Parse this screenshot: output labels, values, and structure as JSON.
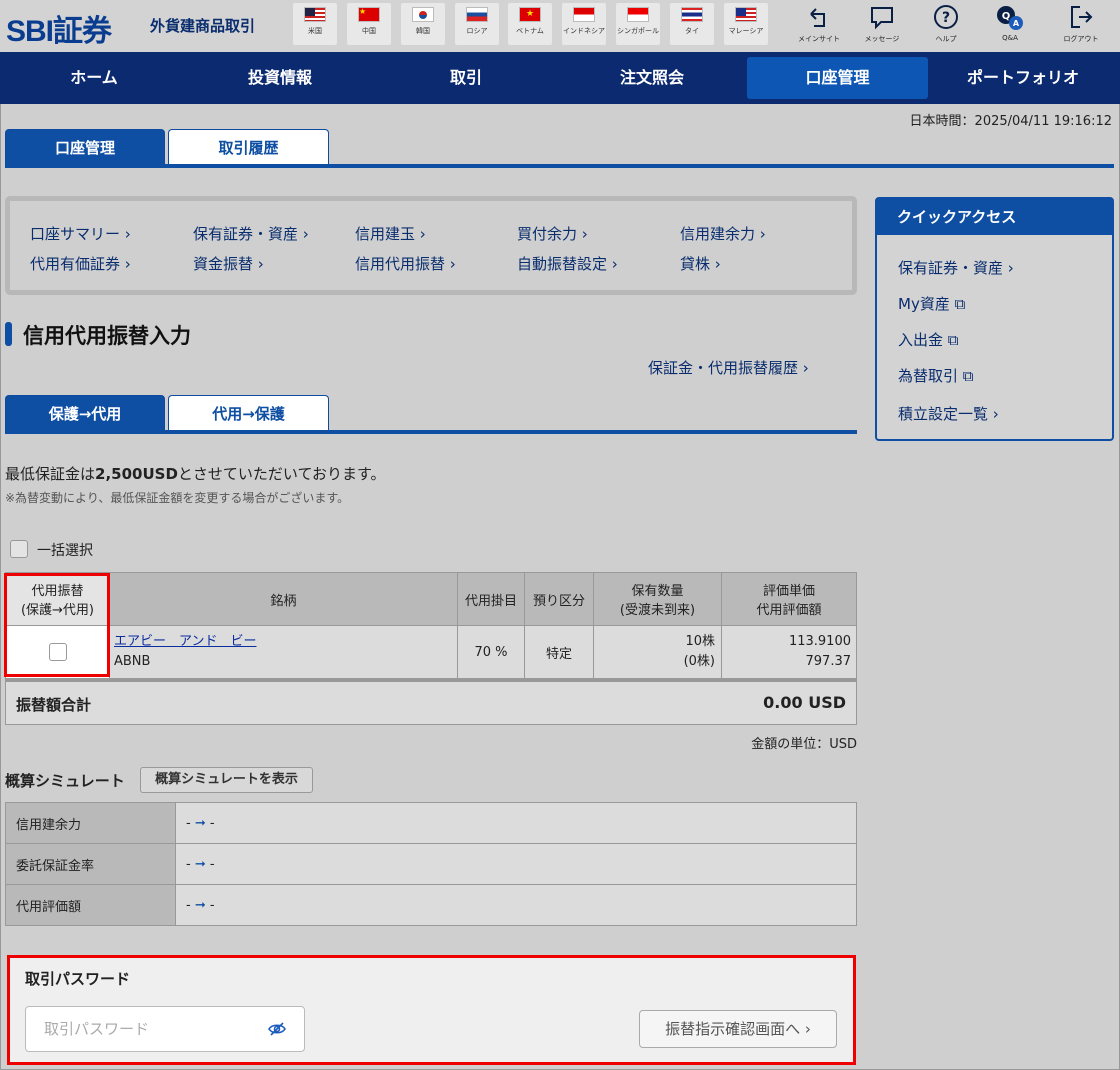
{
  "header": {
    "logo": "SBI証券",
    "subtitle": "外貨建商品取引",
    "flags": [
      {
        "label": "米国",
        "icon": "us-flag-icon"
      },
      {
        "label": "中国",
        "icon": "china-flag-icon"
      },
      {
        "label": "韓国",
        "icon": "korea-flag-icon"
      },
      {
        "label": "ロシア",
        "icon": "russia-flag-icon"
      },
      {
        "label": "ベトナム",
        "icon": "vietnam-flag-icon"
      },
      {
        "label": "インドネシア",
        "icon": "indonesia-flag-icon"
      },
      {
        "label": "シンガポール",
        "icon": "singapore-flag-icon"
      },
      {
        "label": "タイ",
        "icon": "thailand-flag-icon"
      },
      {
        "label": "マレーシア",
        "icon": "malaysia-flag-icon"
      }
    ],
    "tools": [
      {
        "label": "メインサイト",
        "icon": "main-site-icon"
      },
      {
        "label": "メッセージ",
        "icon": "message-icon"
      },
      {
        "label": "ヘルプ",
        "icon": "help-icon"
      },
      {
        "label": "Q&A",
        "icon": "qa-icon"
      },
      {
        "label": "ログアウト",
        "icon": "logout-icon"
      }
    ]
  },
  "nav": [
    "ホーム",
    "投資情報",
    "取引",
    "注文照会",
    "口座管理",
    "ポートフォリオ"
  ],
  "jst": "日本時間：2025/04/11 19:16:12",
  "tabs": {
    "main": [
      "口座管理",
      "取引履歴"
    ],
    "sub": [
      "保護→代用",
      "代用→保護"
    ]
  },
  "menu": [
    "口座サマリー ›",
    "保有証券・資産 ›",
    "信用建玉 ›",
    "買付余力 ›",
    "信用建余力 ›",
    "代用有価証券 ›",
    "資金振替 ›",
    "信用代用振替 ›",
    "自動振替設定 ›",
    "貸株 ›"
  ],
  "page_title": "信用代用振替入力",
  "history_link": "保証金・代用振替履歴 ›",
  "note": {
    "prefix": "最低保証金は",
    "amount": "2,500USD",
    "suffix": "とさせていただいております。",
    "sub": "※為替変動により、最低保証金額を変更する場合がございます。"
  },
  "bulk_select": "一括選択",
  "table": {
    "headers": {
      "transfer": [
        "代用振替",
        "(保護→代用)"
      ],
      "issue": "銘柄",
      "rate": "代用掛目",
      "account": "預り区分",
      "qty": [
        "保有数量",
        "(受渡未到来)"
      ],
      "price": [
        "評価単価",
        "代用評価額"
      ]
    },
    "rows": [
      {
        "name": "エアビー　アンド　ビー",
        "ticker": "ABNB",
        "rate": "70 %",
        "account": "特定",
        "qty": "10株",
        "qty_pending": "(0株)",
        "unit_price": "113.9100",
        "eval": "797.37"
      }
    ],
    "total_label": "振替額合計",
    "total_value": "0.00 USD"
  },
  "unit": "金額の単位：USD",
  "sim": {
    "title": "概算シミュレート",
    "button": "概算シミュレートを表示",
    "rows": [
      {
        "label": "信用建余力",
        "from": "-",
        "to": "-"
      },
      {
        "label": "委託保証金率",
        "from": "-",
        "to": "-"
      },
      {
        "label": "代用評価額",
        "from": "-",
        "to": "-"
      }
    ]
  },
  "password": {
    "title": "取引パスワード",
    "placeholder": "取引パスワード",
    "next": "振替指示確認画面へ ›"
  },
  "quick": {
    "title": "クイックアクセス",
    "links": [
      "保有証券・資産 ›",
      "My資産",
      "入出金",
      "為替取引",
      "積立設定一覧 ›"
    ]
  },
  "colors": {
    "brand": "#0b2a6f",
    "accent": "#0e4fa3",
    "highlight": "#e00000"
  }
}
